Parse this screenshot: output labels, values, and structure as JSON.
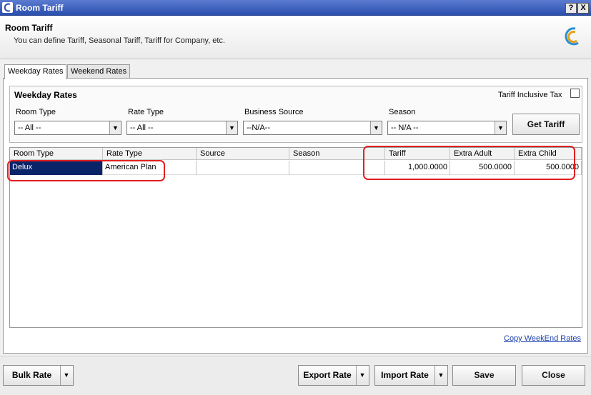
{
  "window": {
    "title": "Room Tariff",
    "help_label": "?",
    "close_label": "X"
  },
  "header": {
    "title": "Room Tariff",
    "subtitle": "You can define Tariff, Seasonal Tariff, Tariff for Company, etc."
  },
  "tabs": [
    {
      "label": "Weekday Rates",
      "active": true
    },
    {
      "label": "Weekend Rates",
      "active": false
    }
  ],
  "filters": {
    "group_title": "Weekday Rates",
    "tariff_inclusive_tax_label": "Tariff Inclusive Tax",
    "tariff_inclusive_tax_checked": false,
    "room_type": {
      "label": "Room Type",
      "value": "-- All --"
    },
    "rate_type": {
      "label": "Rate Type",
      "value": "-- All --"
    },
    "business_source": {
      "label": "Business Source",
      "value": "--N/A--"
    },
    "season": {
      "label": "Season",
      "value": "-- N/A --"
    },
    "get_tariff_label": "Get Tariff"
  },
  "grid": {
    "columns": [
      "Room Type",
      "Rate Type",
      "Source",
      "Season",
      "Tariff",
      "Extra Adult",
      "Extra Child"
    ],
    "rows": [
      [
        "Delux",
        "American Plan",
        "",
        "",
        "1,000.0000",
        "500.0000",
        "500.0000"
      ]
    ]
  },
  "copy_weekend_link": "Copy WeekEnd Rates",
  "footer": {
    "bulk_rate": "Bulk Rate",
    "export_rate": "Export Rate",
    "import_rate": "Import Rate",
    "save": "Save",
    "close": "Close"
  },
  "colors": {
    "title_bar": "#2a4fae",
    "selection": "#0a246a",
    "highlight": "#e02020",
    "link": "#1a3fb0"
  }
}
